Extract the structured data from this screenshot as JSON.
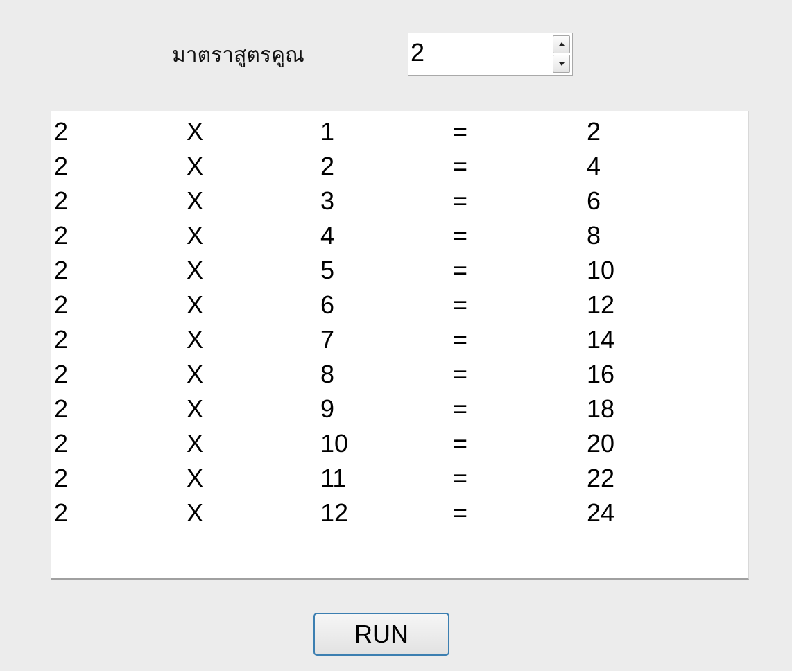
{
  "form": {
    "label": "มาตราสูตรคูณ",
    "spinner_value": "2"
  },
  "table": {
    "rows": [
      [
        "2",
        "X",
        "1",
        "=",
        "2"
      ],
      [
        "2",
        "X",
        "2",
        "=",
        "4"
      ],
      [
        "2",
        "X",
        "3",
        "=",
        "6"
      ],
      [
        "2",
        "X",
        "4",
        "=",
        "8"
      ],
      [
        "2",
        "X",
        "5",
        "=",
        "10"
      ],
      [
        "2",
        "X",
        "6",
        "=",
        "12"
      ],
      [
        "2",
        "X",
        "7",
        "=",
        "14"
      ],
      [
        "2",
        "X",
        "8",
        "=",
        "16"
      ],
      [
        "2",
        "X",
        "9",
        "=",
        "18"
      ],
      [
        "2",
        "X",
        "10",
        "=",
        "20"
      ],
      [
        "2",
        "X",
        "11",
        "=",
        "22"
      ],
      [
        "2",
        "X",
        "12",
        "=",
        "24"
      ]
    ]
  },
  "actions": {
    "run_label": "RUN"
  }
}
